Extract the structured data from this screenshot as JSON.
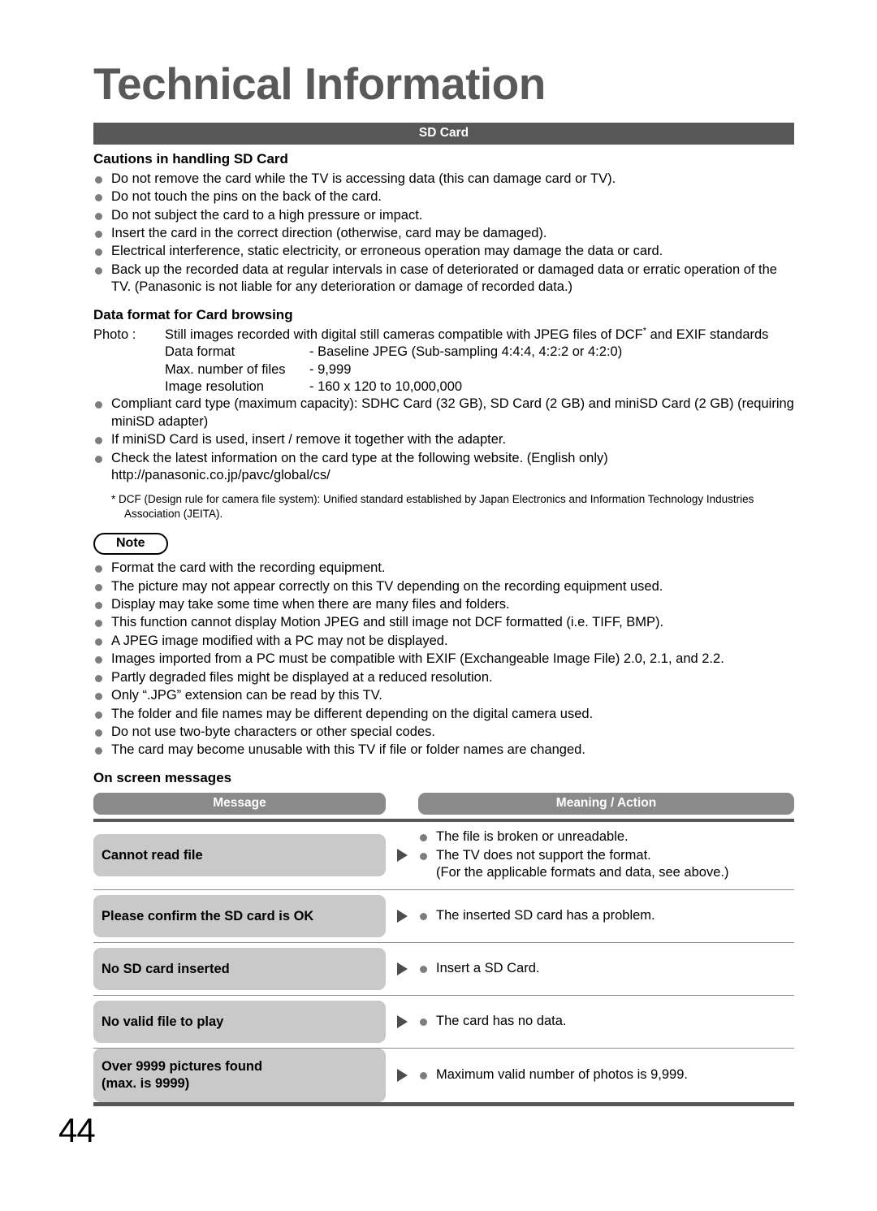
{
  "document": {
    "title": "Technical Information",
    "page_number": "44",
    "section_bar": "SD Card"
  },
  "cautions": {
    "heading": "Cautions in handling SD Card",
    "items": [
      "Do not remove the card while the TV is accessing data (this can damage card or TV).",
      "Do not touch the pins on the back of the card.",
      "Do not subject the card to a high pressure or impact.",
      "Insert the card in the correct direction (otherwise, card may be damaged).",
      "Electrical interference, static electricity, or erroneous operation may damage the data or card.",
      "Back up the recorded data at regular intervals in case of deteriorated or damaged data or erratic operation of the TV. (Panasonic is not liable for any deterioration or damage of recorded data.)"
    ]
  },
  "data_format": {
    "heading": "Data format for Card browsing",
    "photo_label": "Photo :",
    "photo_text_before": "Still images recorded with digital still cameras compatible with JPEG files of DCF",
    "photo_asterisk": "*",
    "photo_text_after": " and EXIF standards",
    "specs": [
      {
        "name": "Data format",
        "value": "- Baseline JPEG (Sub-sampling 4:4:4, 4:2:2 or 4:2:0)"
      },
      {
        "name": "Max. number of files",
        "value": "- 9,999"
      },
      {
        "name": "Image resolution",
        "value": "- 160 x 120 to 10,000,000"
      }
    ],
    "bullets": [
      "Compliant card type (maximum capacity): SDHC Card (32 GB), SD Card (2 GB) and miniSD Card (2 GB) (requiring miniSD adapter)",
      "If miniSD Card is used, insert / remove it together with the adapter.",
      "Check the latest information on the card type at the following website. (English only) http://panasonic.co.jp/pavc/global/cs/"
    ],
    "footnote": "* DCF (Design rule for camera file system): Unified standard established by Japan Electronics and Information Technology Industries Association (JEITA)."
  },
  "note": {
    "badge": "Note",
    "items": [
      "Format the card with the recording equipment.",
      "The picture may not appear correctly on this TV depending on the recording equipment used.",
      "Display may take some time when there are many files and folders.",
      "This function cannot display Motion JPEG and still image not DCF formatted (i.e. TIFF, BMP).",
      "A JPEG image modified with a PC may not be displayed.",
      "Images imported from a PC must be compatible with EXIF (Exchangeable Image File) 2.0, 2.1, and 2.2.",
      "Partly degraded files might be displayed at a reduced resolution.",
      "Only “.JPG” extension can be read by this TV.",
      "The folder and file names may be different depending on the digital camera used.",
      "Do not use two-byte characters or other special codes.",
      "The card may become unusable with this TV if file or folder names are changed."
    ]
  },
  "messages_table": {
    "heading": "On screen messages",
    "col_message": "Message",
    "col_meaning": "Meaning / Action",
    "rows": [
      {
        "message": "Cannot read file",
        "message_line2": "",
        "meanings": [
          "The file is broken or unreadable.",
          "The TV does not support the format."
        ],
        "sub_note": "(For the applicable formats and data, see above.)"
      },
      {
        "message": "Please confirm the SD card is OK",
        "message_line2": "",
        "meanings": [
          "The inserted SD card has a problem."
        ],
        "sub_note": ""
      },
      {
        "message": "No SD card inserted",
        "message_line2": "",
        "meanings": [
          "Insert a SD Card."
        ],
        "sub_note": ""
      },
      {
        "message": "No valid file to play",
        "message_line2": "",
        "meanings": [
          "The card has no data."
        ],
        "sub_note": ""
      },
      {
        "message": "Over 9999 pictures found",
        "message_line2": "(max. is 9999)",
        "meanings": [
          "Maximum valid number of photos is 9,999."
        ],
        "sub_note": ""
      }
    ]
  },
  "colors": {
    "section_bar": "#575757",
    "title": "#595959",
    "header_pill": "#8a8a8a",
    "row_pill": "#c9c9c9",
    "bullet": "#7d7d7d"
  }
}
